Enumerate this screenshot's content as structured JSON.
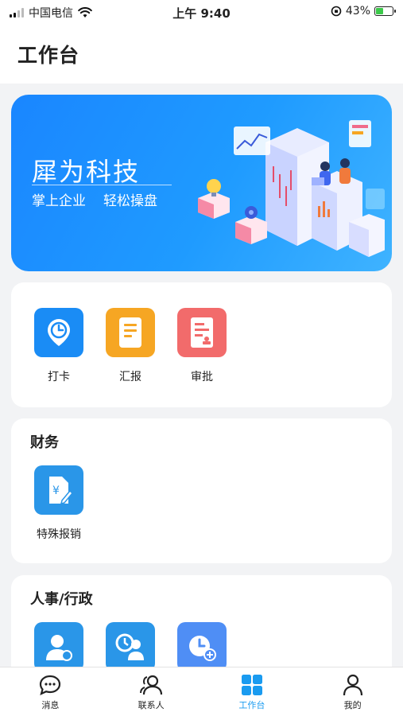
{
  "status_bar": {
    "carrier": "中国电信",
    "time": "上午 9:40",
    "battery": "43%",
    "battery_level": 0.43
  },
  "header": {
    "title": "工作台"
  },
  "banner": {
    "title": "犀为科技",
    "subtitle_left": "掌上企业",
    "subtitle_right": "轻松操盘"
  },
  "quick_apps": [
    {
      "label": "打卡",
      "icon": "clock-location-icon",
      "color": "#1a8cf5"
    },
    {
      "label": "汇报",
      "icon": "report-document-icon",
      "color": "#f6a623"
    },
    {
      "label": "审批",
      "icon": "approval-document-icon",
      "color": "#f26b6b"
    }
  ],
  "finance": {
    "title": "财务",
    "apps": [
      {
        "label": "特殊报销",
        "icon": "reimbursement-icon",
        "color": "#2a96e8"
      }
    ]
  },
  "hr": {
    "title": "人事/行政",
    "apps": [
      {
        "icon": "employee-upload-icon",
        "color": "#2a96e8"
      },
      {
        "icon": "people-clock-icon",
        "color": "#2a96e8"
      },
      {
        "icon": "clock-add-icon",
        "color": "#4f8ef5"
      }
    ]
  },
  "tab_bar": {
    "tabs": [
      {
        "label": "消息",
        "icon": "chat-bubble-icon"
      },
      {
        "label": "联系人",
        "icon": "contacts-icon"
      },
      {
        "label": "工作台",
        "icon": "grid-icon",
        "active": true
      },
      {
        "label": "我的",
        "icon": "person-icon"
      }
    ],
    "active_color": "#1a9bf0"
  }
}
